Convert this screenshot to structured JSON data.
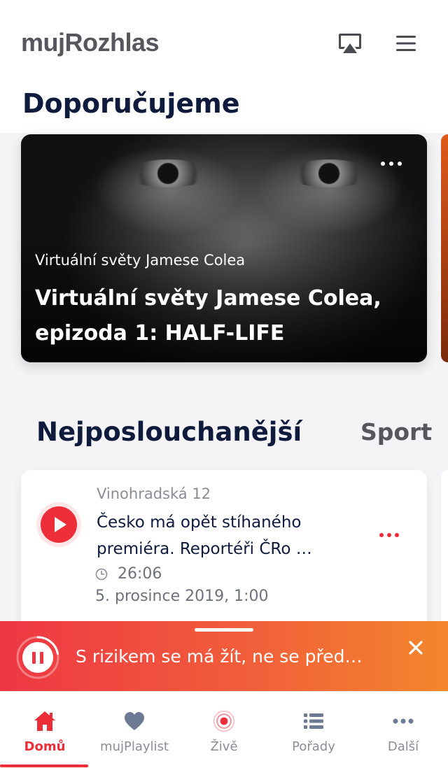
{
  "header": {
    "logo": "mujRozhlas",
    "airplay_icon": "airplay-icon",
    "menu_icon": "hamburger-menu-icon"
  },
  "recommended": {
    "title": "Doporučujeme",
    "card": {
      "subtitle": "Virtuální světy Jamese Colea",
      "title": "Virtuální světy Jamese Colea, epizoda 1: HALF-LIFE",
      "more_icon": "more-dots-icon"
    }
  },
  "popular": {
    "title": "Nejposlouchanější",
    "next_tab": "Sport",
    "episode": {
      "show": "Vinohradská 12",
      "title": "Česko má opět stíhaného premiéra. Reportéři ČRo …",
      "duration": "26:06",
      "date": "5. prosince 2019, 1:00",
      "play_icon": "play-icon",
      "clock_icon": "clock-icon",
      "more_icon": "more-dots-icon"
    }
  },
  "player": {
    "now_playing": "S rizikem se má žít, ne se před…",
    "progress": 0.22,
    "pause_icon": "pause-icon",
    "close_icon": "close-icon"
  },
  "nav": {
    "items": [
      {
        "label": "Domů",
        "icon": "home-icon",
        "active": true
      },
      {
        "label": "mujPlaylist",
        "icon": "heart-icon",
        "active": false
      },
      {
        "label": "Živě",
        "icon": "live-icon",
        "active": false
      },
      {
        "label": "Pořady",
        "icon": "list-icon",
        "active": false
      },
      {
        "label": "Další",
        "icon": "more-dots-icon",
        "active": false
      }
    ]
  },
  "colors": {
    "accent": "#ed2e38",
    "navy": "#0f1b3d",
    "player_gradient_start": "#ee3744",
    "player_gradient_end": "#f3872c"
  }
}
